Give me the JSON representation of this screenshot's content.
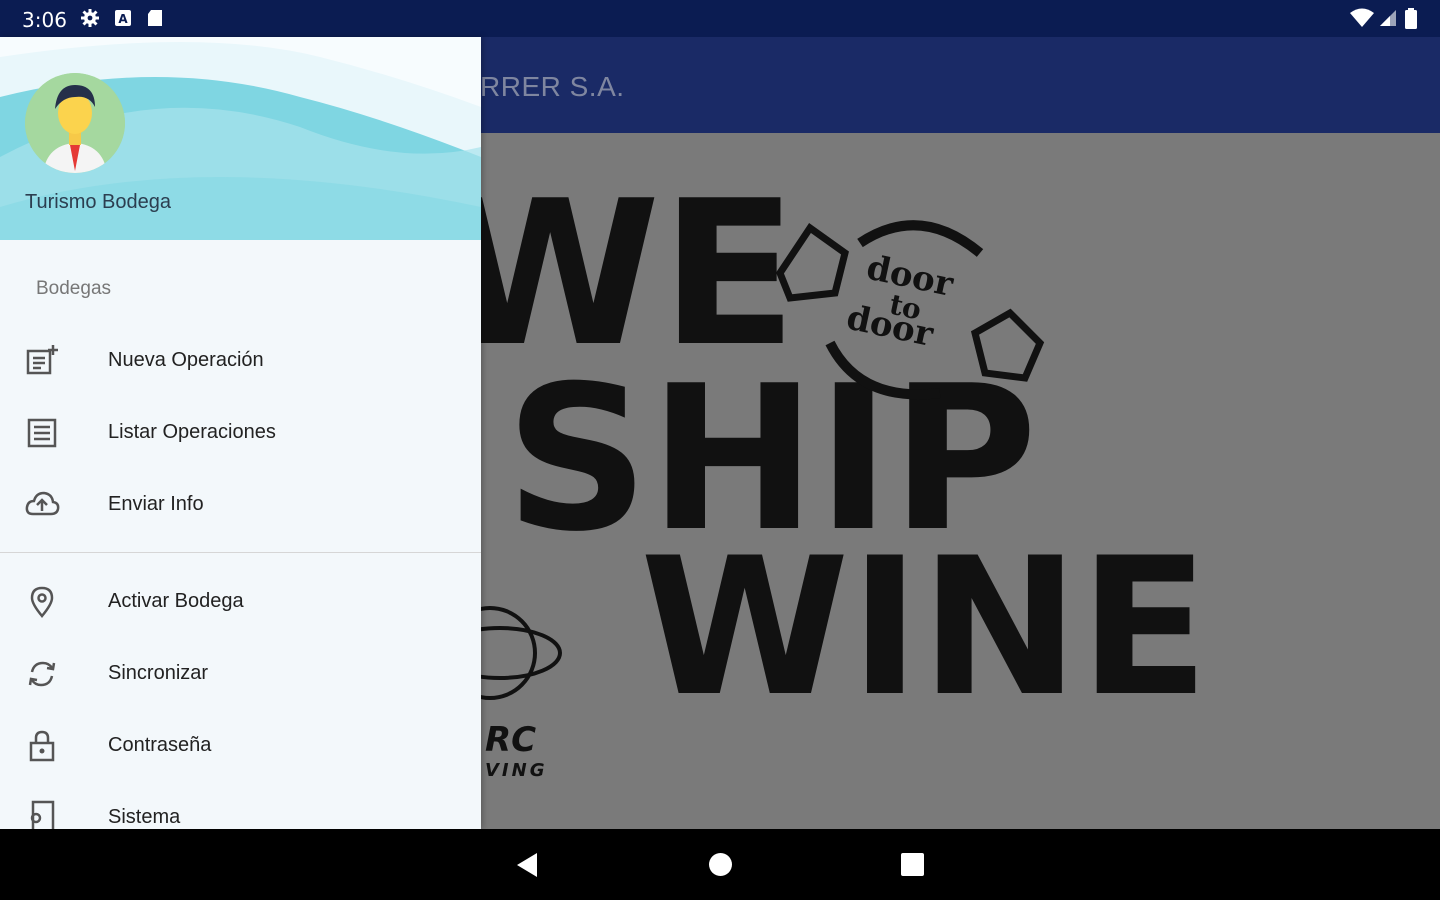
{
  "status_bar": {
    "time": "3:06"
  },
  "app_bar": {
    "title": "RRER S.A."
  },
  "drawer": {
    "user_name": "Turismo Bodega",
    "section_label": "Bodegas",
    "items": [
      {
        "label": "Nueva Operación",
        "icon": "note-add-icon"
      },
      {
        "label": "Listar Operaciones",
        "icon": "list-icon"
      },
      {
        "label": "Enviar Info",
        "icon": "cloud-upload-icon"
      },
      {
        "label": "Activar Bodega",
        "icon": "location-pin-icon"
      },
      {
        "label": "Sincronizar",
        "icon": "sync-icon"
      },
      {
        "label": "Contraseña",
        "icon": "lock-icon"
      },
      {
        "label": "Sistema",
        "icon": "settings-phone-icon"
      }
    ]
  },
  "background_logo": {
    "words": [
      "WE",
      "SHIP",
      "WINE"
    ],
    "badge": [
      "door",
      "to",
      "door"
    ],
    "partial_text": [
      "RC",
      "VING"
    ]
  },
  "colors": {
    "status_bar": "#0b1c52",
    "app_bar": "#1a2a66",
    "drawer_bg": "#f3f8fb",
    "header_wave": "#c7ecf2"
  }
}
